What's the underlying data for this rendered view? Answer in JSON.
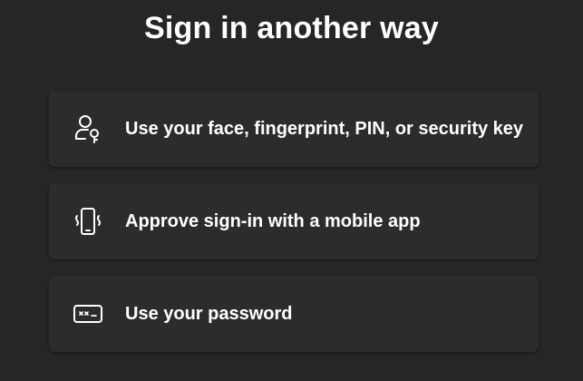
{
  "page_title": "Sign in another way",
  "options": [
    {
      "label": "Use your face, fingerprint, PIN, or security key",
      "icon": "user-key-icon"
    },
    {
      "label": "Approve sign-in with a mobile app",
      "icon": "mobile-phone-icon"
    },
    {
      "label": "Use your password",
      "icon": "password-icon"
    }
  ],
  "colors": {
    "background": "#262626",
    "card": "#2c2c2c",
    "text": "#ffffff"
  }
}
